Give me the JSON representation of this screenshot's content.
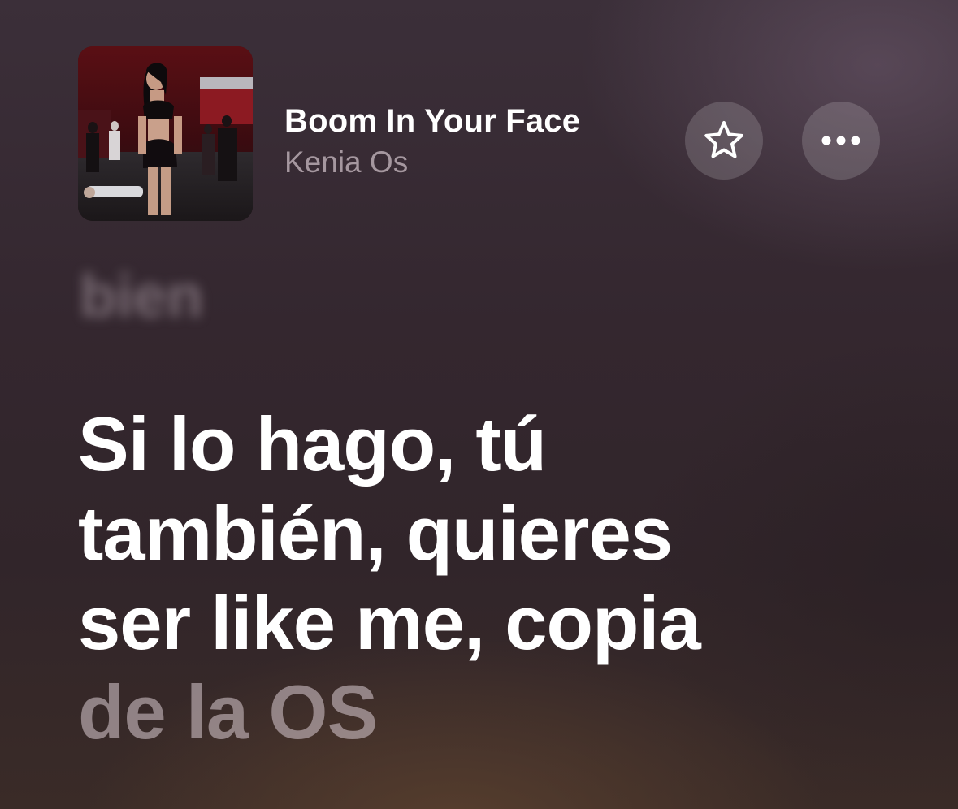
{
  "now_playing": {
    "title": "Boom In Your Face",
    "artist": "Kenia Os",
    "album_art_icon": "album-cover-image",
    "favorite_icon": "star-icon",
    "more_icon": "ellipsis-icon"
  },
  "lyrics": {
    "previous_line": "bien",
    "current_lines": [
      "Si lo hago, tú",
      "también, quieres",
      "ser like me, copia",
      "de la OS"
    ],
    "sung_line_count": 3
  },
  "colors": {
    "primary_text": "#ffffff",
    "secondary_text": "#a5979f",
    "upcoming_lyric": "#c8babe",
    "background": "#34272f"
  }
}
